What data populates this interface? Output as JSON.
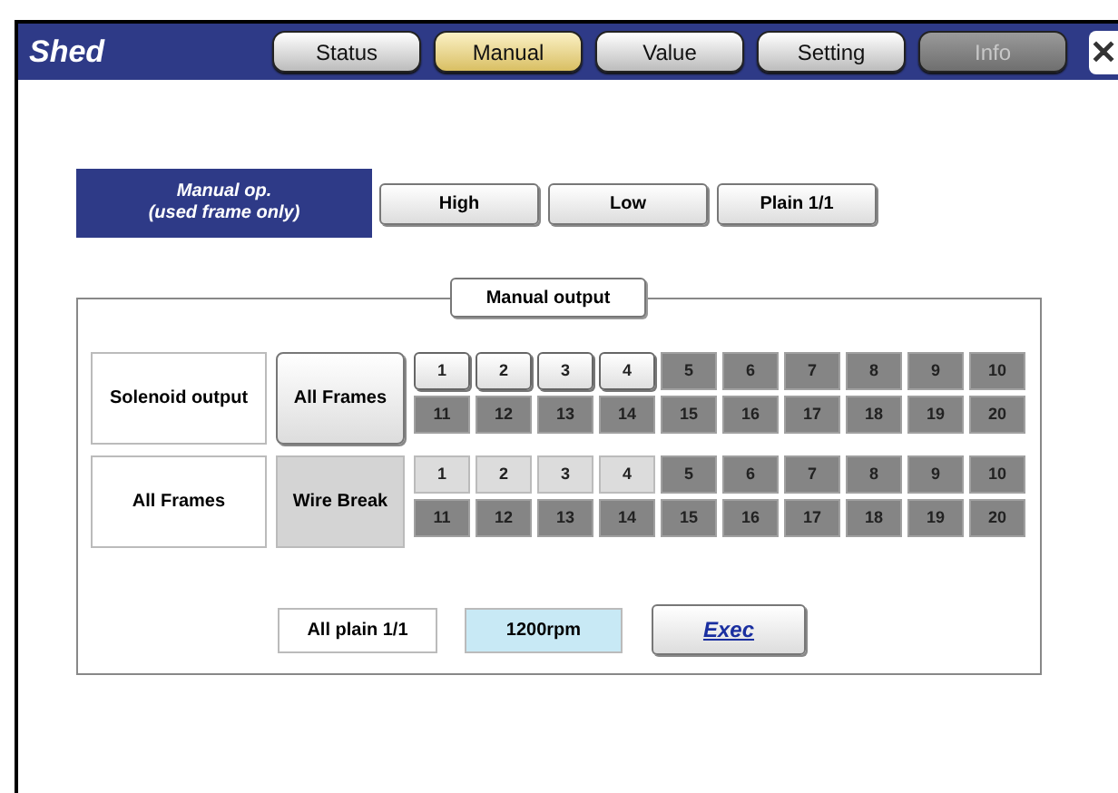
{
  "window": {
    "title": "Shed"
  },
  "tabs": [
    {
      "label": "Status",
      "selected": false,
      "disabled": false
    },
    {
      "label": "Manual",
      "selected": true,
      "disabled": false
    },
    {
      "label": "Value",
      "selected": false,
      "disabled": false
    },
    {
      "label": "Setting",
      "selected": false,
      "disabled": false
    },
    {
      "label": "Info",
      "selected": false,
      "disabled": true
    }
  ],
  "close_button": {
    "label": "✕"
  },
  "manual_op": {
    "label": "Manual op.\n(used frame only)",
    "buttons": [
      "High",
      "Low",
      "Plain 1/1"
    ]
  },
  "manual_output": {
    "legend": "Manual output",
    "rows": [
      {
        "label": "Solenoid output",
        "button": "All Frames",
        "kind": "button",
        "cells": [
          [
            {
              "label": "1",
              "enabled": true
            },
            {
              "label": "2",
              "enabled": true
            },
            {
              "label": "3",
              "enabled": true
            },
            {
              "label": "4",
              "enabled": true
            },
            {
              "label": "5",
              "enabled": false
            },
            {
              "label": "6",
              "enabled": false
            },
            {
              "label": "7",
              "enabled": false
            },
            {
              "label": "8",
              "enabled": false
            },
            {
              "label": "9",
              "enabled": false
            },
            {
              "label": "10",
              "enabled": false
            }
          ],
          [
            {
              "label": "11",
              "enabled": false
            },
            {
              "label": "12",
              "enabled": false
            },
            {
              "label": "13",
              "enabled": false
            },
            {
              "label": "14",
              "enabled": false
            },
            {
              "label": "15",
              "enabled": false
            },
            {
              "label": "16",
              "enabled": false
            },
            {
              "label": "17",
              "enabled": false
            },
            {
              "label": "18",
              "enabled": false
            },
            {
              "label": "19",
              "enabled": false
            },
            {
              "label": "20",
              "enabled": false
            }
          ]
        ]
      },
      {
        "label": "All Frames",
        "button": "Wire Break",
        "kind": "indicator",
        "cells": [
          [
            {
              "label": "1",
              "enabled": true
            },
            {
              "label": "2",
              "enabled": true
            },
            {
              "label": "3",
              "enabled": true
            },
            {
              "label": "4",
              "enabled": true
            },
            {
              "label": "5",
              "enabled": false
            },
            {
              "label": "6",
              "enabled": false
            },
            {
              "label": "7",
              "enabled": false
            },
            {
              "label": "8",
              "enabled": false
            },
            {
              "label": "9",
              "enabled": false
            },
            {
              "label": "10",
              "enabled": false
            }
          ],
          [
            {
              "label": "11",
              "enabled": false
            },
            {
              "label": "12",
              "enabled": false
            },
            {
              "label": "13",
              "enabled": false
            },
            {
              "label": "14",
              "enabled": false
            },
            {
              "label": "15",
              "enabled": false
            },
            {
              "label": "16",
              "enabled": false
            },
            {
              "label": "17",
              "enabled": false
            },
            {
              "label": "18",
              "enabled": false
            },
            {
              "label": "19",
              "enabled": false
            },
            {
              "label": "20",
              "enabled": false
            }
          ]
        ]
      }
    ],
    "plain_display": "All plain 1/1",
    "speed_display": "1200rpm",
    "exec_button": "Exec"
  }
}
